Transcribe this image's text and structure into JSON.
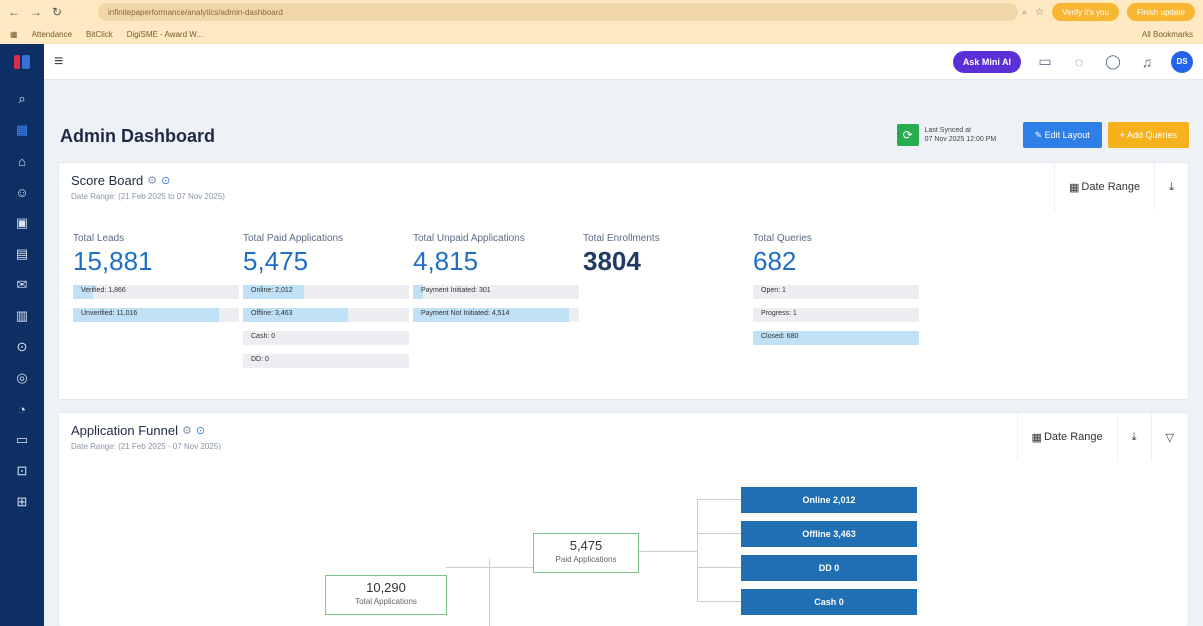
{
  "browser": {
    "url": "infinitepaperformance/analytics/admin-dashboard",
    "right_buttons": [
      "Verify it's you",
      "Finish update"
    ],
    "bookmarks": [
      "Attendance",
      "BitClick",
      "DigiSME - Award W..."
    ],
    "all_bookmarks": "All Bookmarks"
  },
  "header": {
    "ask_label": "Ask Mini AI",
    "avatar_initials": "DS"
  },
  "page": {
    "title": "Admin Dashboard",
    "last_synced_label": "Last Synced at",
    "last_synced_time": "07 Nov 2025 12:00 PM",
    "edit_layout": "Edit Layout",
    "add_queries": "+ Add Queries"
  },
  "scoreboard": {
    "title": "Score Board",
    "date_range_text": "Date Range: (21 Feb 2025 to 07 Nov 2025)",
    "date_range_btn": "Date Range",
    "metrics": [
      {
        "label": "Total Leads",
        "value": "15,881",
        "bars": [
          {
            "text": "Verified: 1,866",
            "fill": 0.12
          },
          {
            "text": "Unverified: 11,016",
            "fill": 0.88
          }
        ]
      },
      {
        "label": "Total Paid Applications",
        "value": "5,475",
        "bars": [
          {
            "text": "Online: 2,012",
            "fill": 0.37
          },
          {
            "text": "Offline: 3,463",
            "fill": 0.63
          },
          {
            "text": "Cash: 0",
            "fill": 0
          },
          {
            "text": "DD: 0",
            "fill": 0
          }
        ]
      },
      {
        "label": "Total Unpaid Applications",
        "value": "4,815",
        "bars": [
          {
            "text": "Payment Initiated: 301",
            "fill": 0.06
          },
          {
            "text": "Payment Not Initiated: 4,514",
            "fill": 0.94
          }
        ]
      },
      {
        "label": "Total Enrollments",
        "value": "3804",
        "bars": []
      },
      {
        "label": "Total Queries",
        "value": "682",
        "bars": [
          {
            "text": "Open: 1",
            "fill": 0
          },
          {
            "text": "Progress: 1",
            "fill": 0
          },
          {
            "text": "Closed: 680",
            "fill": 1
          }
        ]
      }
    ]
  },
  "funnel": {
    "title": "Application Funnel",
    "date_range_text": "Date Range: (21 Feb 2025 - 07 Nov 2025)",
    "date_range_btn": "Date Range",
    "total": {
      "num": "10,290",
      "label": "Total Applications"
    },
    "paid": {
      "num": "5,475",
      "label": "Paid Applications"
    },
    "children": [
      "Online 2,012",
      "Offline 3,463",
      "DD 0",
      "Cash 0"
    ]
  }
}
